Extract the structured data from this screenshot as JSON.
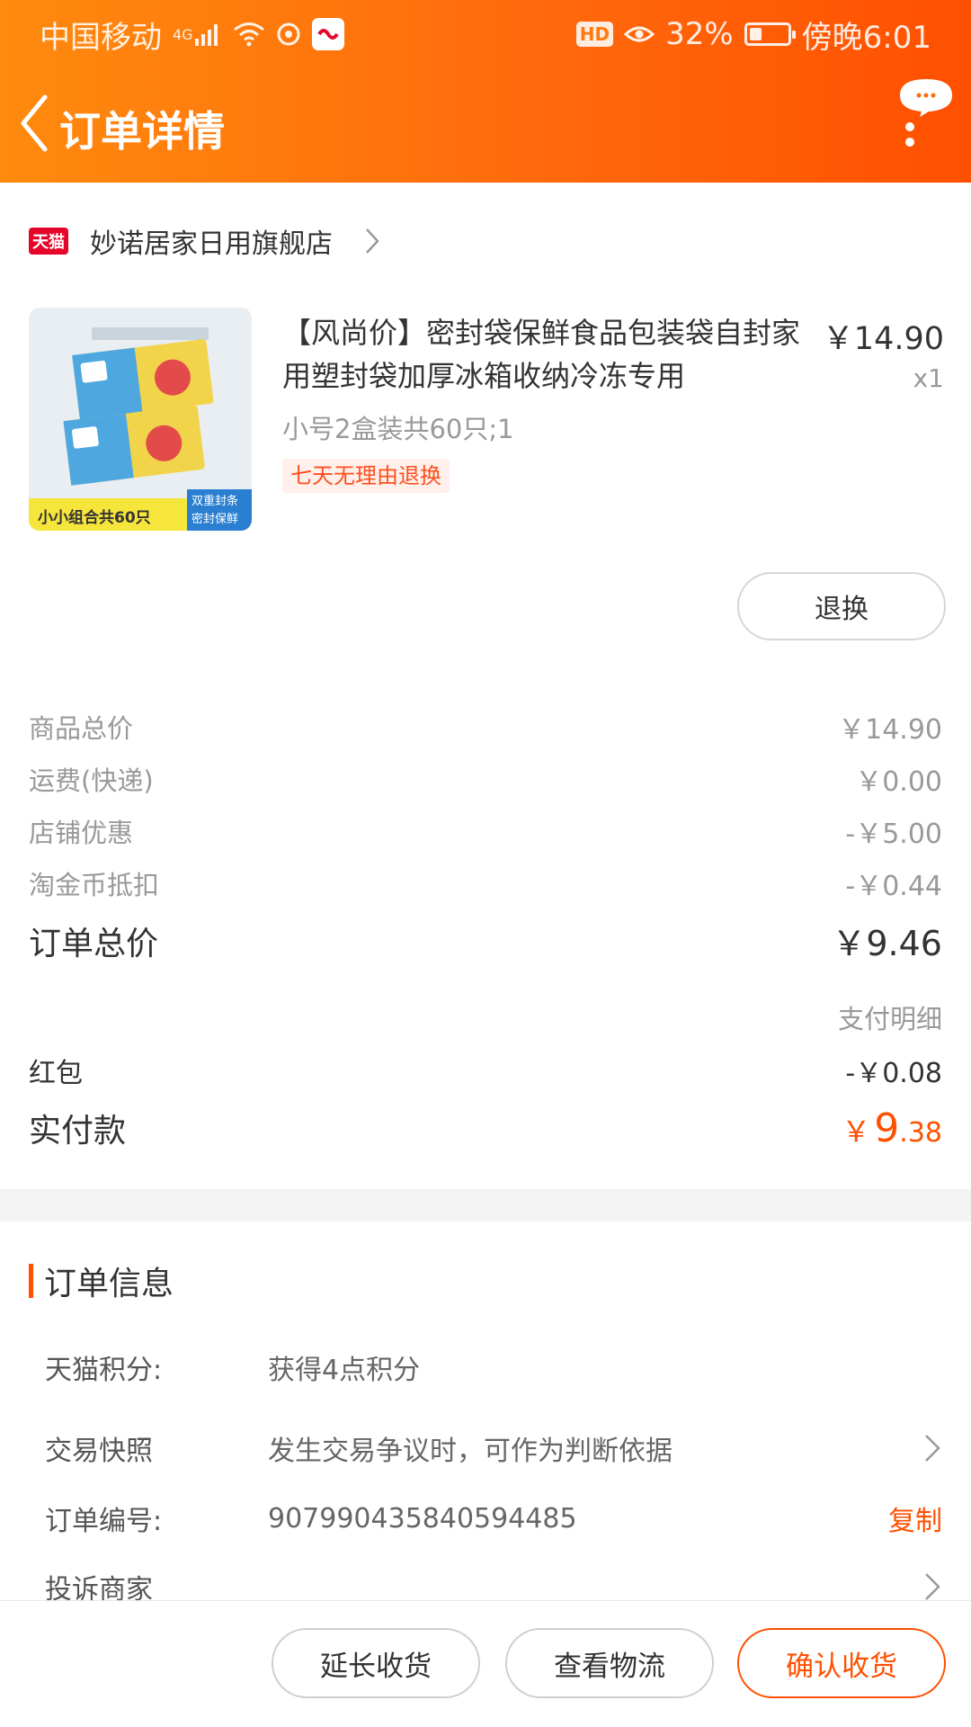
{
  "status_bar": {
    "carrier": "中国移动",
    "network": "4G",
    "battery_percent": "32%",
    "time": "傍晚6:01",
    "hd_label": "HD",
    "app_badge_text": "淘宝"
  },
  "nav": {
    "title": "订单详情",
    "more_icon": "chat-bubble-more-icon"
  },
  "shop": {
    "platform_badge": "天猫",
    "name": "妙诺居家日用旗舰店"
  },
  "product": {
    "title": "【风尚价】密封袋保鲜食品包装袋自封家用塑封袋加厚冰箱收纳冷冻专用",
    "price": "￥14.90",
    "quantity": "x1",
    "sku": "小号2盒装共60只;1",
    "tag": "七天无理由退换",
    "return_button": "退换",
    "image_caption": "小小组合共60只",
    "image_badge_line1": "双重封条",
    "image_badge_line2": "密封保鲜"
  },
  "price_list": {
    "items": [
      {
        "label": "商品总价",
        "value": "￥14.90"
      },
      {
        "label": "运费(快递)",
        "value": "￥0.00"
      },
      {
        "label": "店铺优惠",
        "value": "-￥5.00"
      },
      {
        "label": "淘金币抵扣",
        "value": "-￥0.44"
      }
    ],
    "total_label": "订单总价",
    "total_value": "￥9.46",
    "detail_link": "支付明细",
    "red_packet_label": "红包",
    "red_packet_value": "-￥0.08",
    "paid_label": "实付款",
    "paid_currency": "￥",
    "paid_int": "9",
    "paid_dec": ".38"
  },
  "order_info": {
    "title": "订单信息",
    "rows": [
      {
        "key": "天猫积分:",
        "value": "获得4点积分"
      },
      {
        "key": "交易快照",
        "value": "发生交易争议时，可作为判断依据"
      },
      {
        "key": "订单编号:",
        "value": "907990435840594485",
        "action": "复制"
      },
      {
        "key": "投诉商家",
        "value": ""
      }
    ]
  },
  "bottom_actions": {
    "extend": "延长收货",
    "logistics": "查看物流",
    "confirm": "确认收货"
  },
  "colors": {
    "accent": "#ff5000",
    "header_start": "#ff8a0e",
    "header_end": "#ff5000",
    "tmall_red": "#e4062b"
  }
}
